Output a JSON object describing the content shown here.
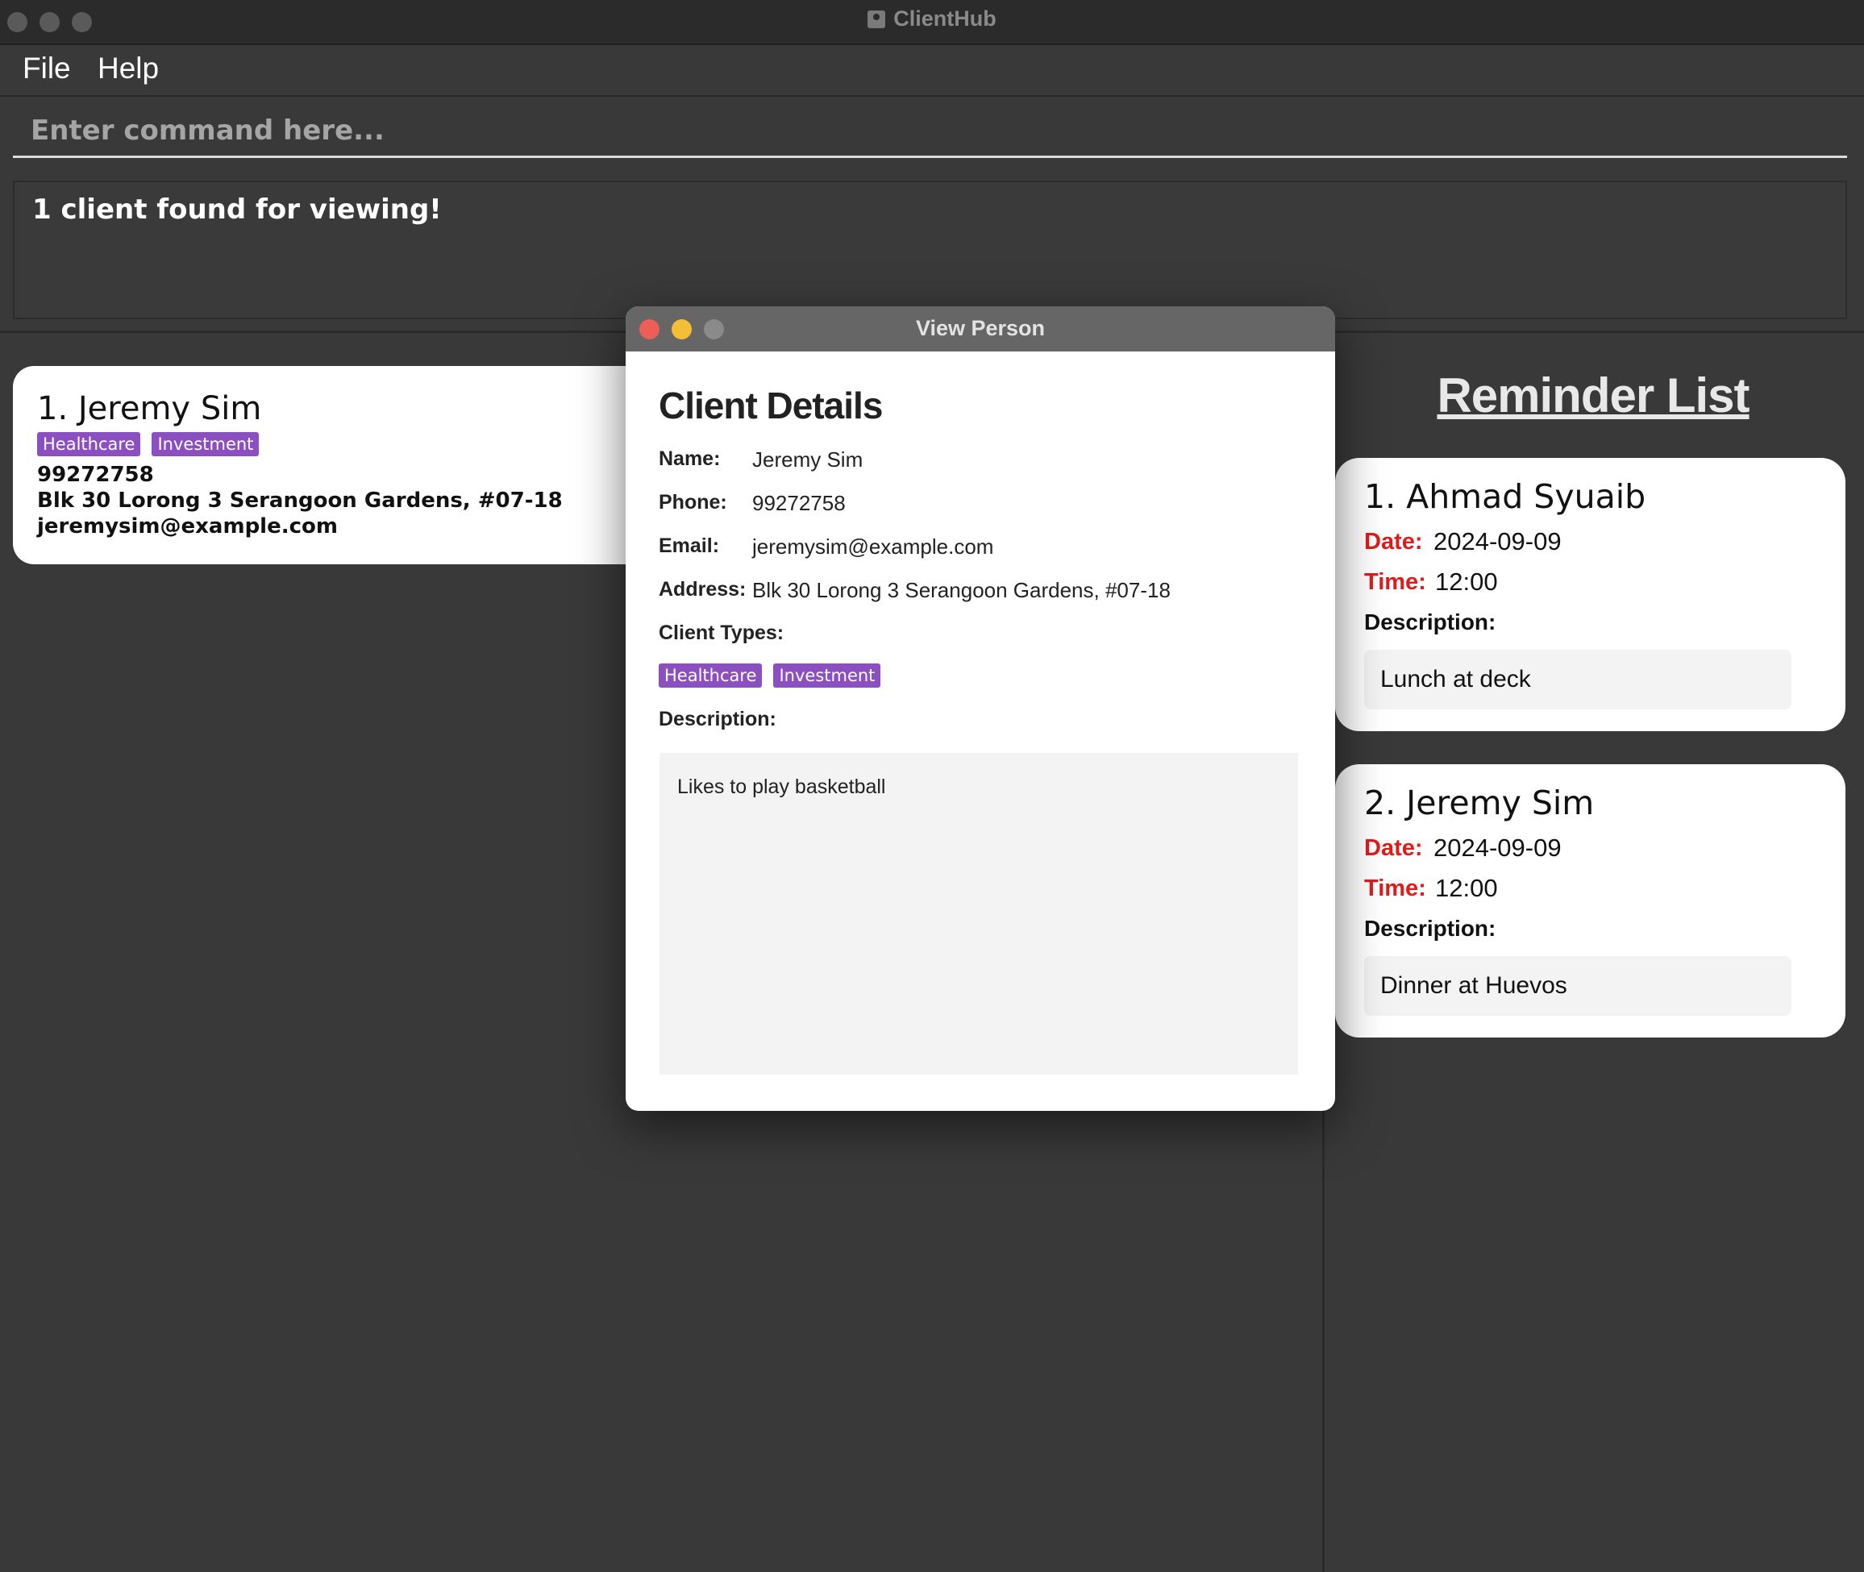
{
  "window": {
    "title": "ClientHub"
  },
  "menu": {
    "file": "File",
    "help": "Help"
  },
  "command": {
    "placeholder": "Enter command here..."
  },
  "result": {
    "message": "1 client found for viewing!"
  },
  "person_list": [
    {
      "index_name": "1. Jeremy Sim",
      "tags": [
        "Healthcare",
        "Investment"
      ],
      "phone": "99272758",
      "address": "Blk 30 Lorong 3 Serangoon Gardens, #07-18",
      "email": "jeremysim@example.com"
    }
  ],
  "reminders": {
    "title": "Reminder List",
    "date_label": "Date:",
    "time_label": "Time:",
    "description_label": "Description:",
    "items": [
      {
        "index_name": "1.  Ahmad Syuaib",
        "date": "2024-09-09",
        "time": "12:00",
        "description": "Lunch at deck"
      },
      {
        "index_name": "2.  Jeremy Sim",
        "date": "2024-09-09",
        "time": "12:00",
        "description": "Dinner at Huevos"
      }
    ]
  },
  "dialog": {
    "title": "View Person",
    "heading": "Client Details",
    "name_label": "Name:",
    "name": "Jeremy Sim",
    "phone_label": "Phone:",
    "phone": "99272758",
    "email_label": "Email:",
    "email": "jeremysim@example.com",
    "address_label": "Address:",
    "address": "Blk 30 Lorong 3 Serangoon Gardens, #07-18",
    "client_types_label": "Client Types:",
    "client_types": [
      "Healthcare",
      "Investment"
    ],
    "description_label": "Description:",
    "description": "Likes to play basketball"
  },
  "colors": {
    "tag": "#8c4fc2",
    "reminder_label": "#e01b1b",
    "close": "#ec5f57",
    "minimize": "#f4bf36",
    "zoom_disabled": "#8a8a8a"
  }
}
